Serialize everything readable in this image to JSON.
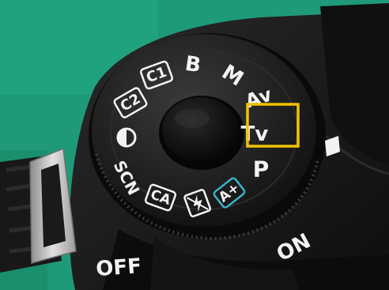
{
  "mode_dial": {
    "modes": [
      {
        "label": "B",
        "kind": "text"
      },
      {
        "label": "M",
        "kind": "text"
      },
      {
        "label": "Av",
        "kind": "text"
      },
      {
        "label": "Tv",
        "kind": "text",
        "highlighted": true
      },
      {
        "label": "P",
        "kind": "text"
      },
      {
        "label": "A+",
        "kind": "boxed-text",
        "color": "#37b4c4"
      },
      {
        "label": "no-flash-icon",
        "kind": "icon"
      },
      {
        "label": "CA",
        "kind": "boxed-text"
      },
      {
        "label": "SCN",
        "kind": "text"
      },
      {
        "label": "creative-filter-icon",
        "kind": "icon"
      },
      {
        "label": "C2",
        "kind": "boxed-text"
      },
      {
        "label": "C1",
        "kind": "boxed-text"
      }
    ],
    "highlight_color": "#f2c200",
    "dial_color": "#1a1a1a",
    "label_color": "#f3f3f3"
  },
  "power_switch": {
    "off_label": "OFF",
    "on_label": "ON"
  },
  "colors": {
    "background": "#1f9a78",
    "camera_body": "#161616",
    "strap_lug": "#c9c9c9"
  }
}
